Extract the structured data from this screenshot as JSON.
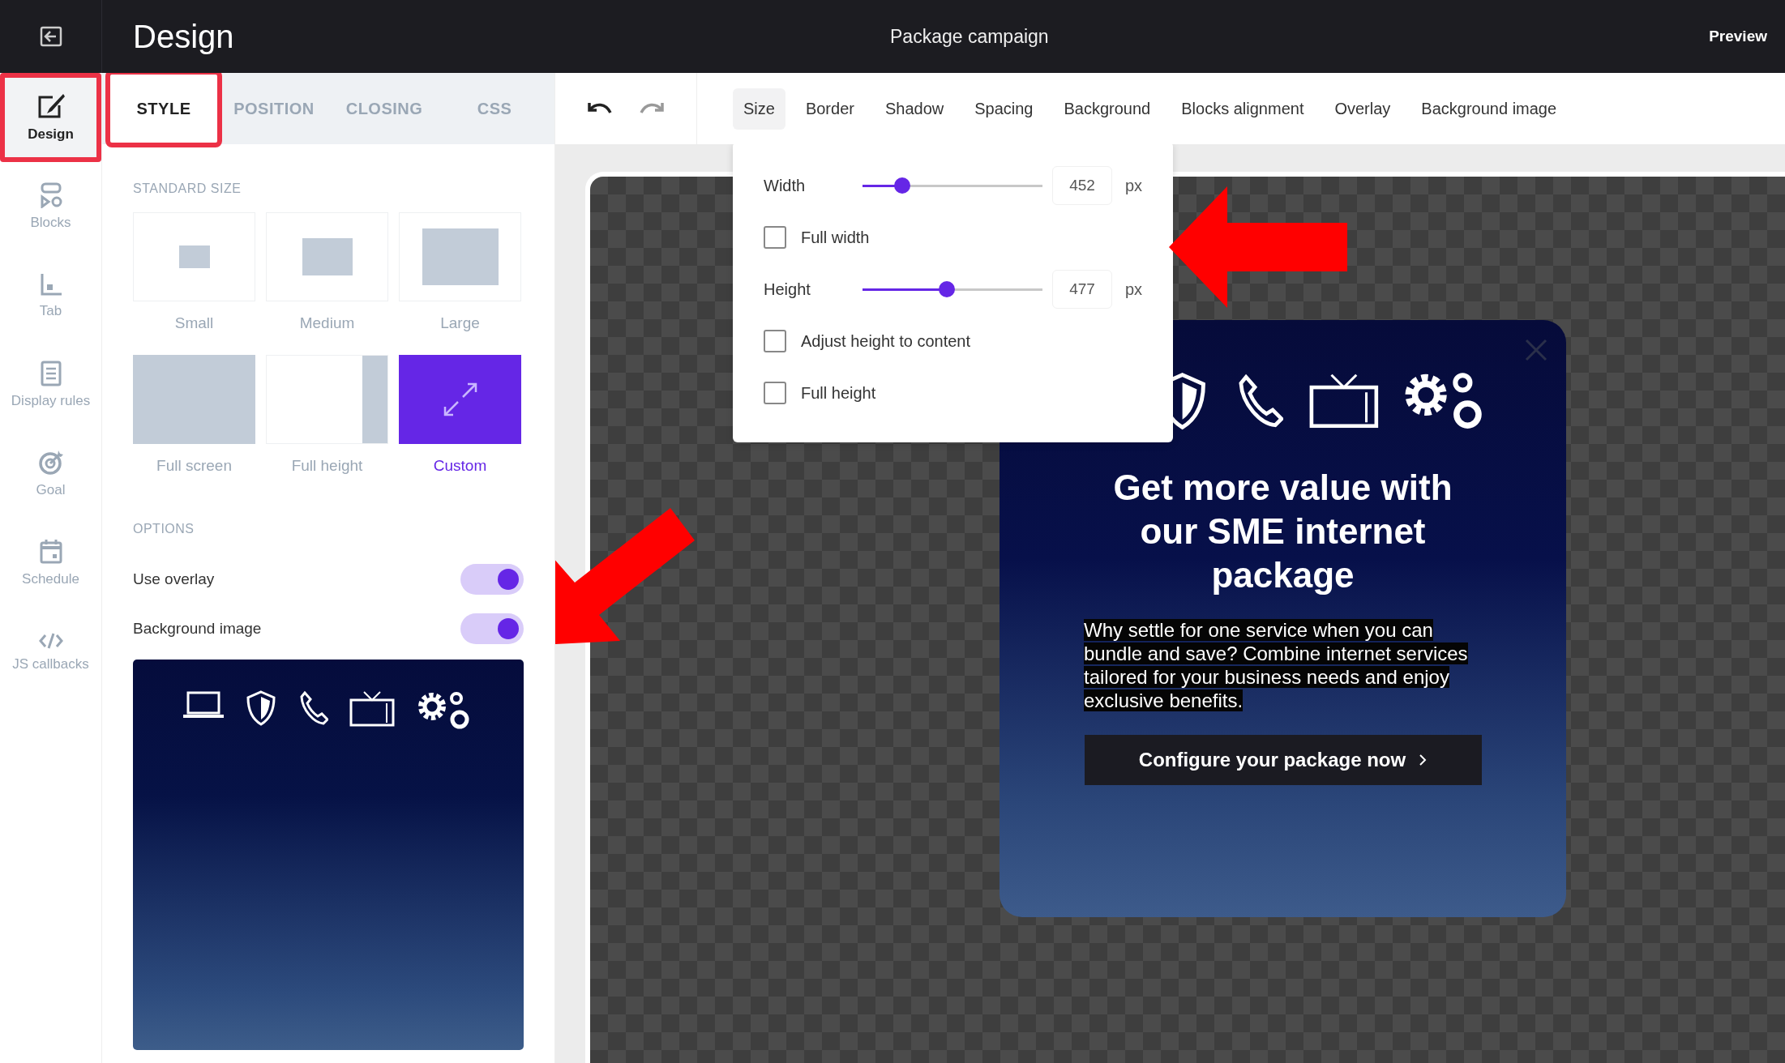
{
  "header": {
    "title": "Design",
    "campaign": "Package campaign",
    "preview": "Preview"
  },
  "rail": [
    {
      "label": "Design",
      "selected": true,
      "highlighted": true
    },
    {
      "label": "Blocks",
      "selected": false,
      "highlighted": false
    },
    {
      "label": "Tab",
      "selected": false,
      "highlighted": false
    },
    {
      "label": "Display rules",
      "selected": false,
      "highlighted": false
    },
    {
      "label": "Goal",
      "selected": false,
      "highlighted": false
    },
    {
      "label": "Schedule",
      "selected": false,
      "highlighted": false
    },
    {
      "label": "JS callbacks",
      "selected": false,
      "highlighted": false
    }
  ],
  "panel_tabs": [
    {
      "label": "STYLE",
      "selected": true,
      "highlighted": true
    },
    {
      "label": "POSITION",
      "selected": false,
      "highlighted": false
    },
    {
      "label": "CLOSING",
      "selected": false,
      "highlighted": false
    },
    {
      "label": "CSS",
      "selected": false,
      "highlighted": false
    }
  ],
  "standard_size": {
    "heading": "STANDARD SIZE",
    "options": [
      {
        "kind": "small",
        "label": "Small",
        "selected": false
      },
      {
        "kind": "medium",
        "label": "Medium",
        "selected": false
      },
      {
        "kind": "large",
        "label": "Large",
        "selected": false
      },
      {
        "kind": "full-screen",
        "label": "Full screen",
        "selected": false
      },
      {
        "kind": "full-height",
        "label": "Full height",
        "selected": false
      },
      {
        "kind": "custom",
        "label": "Custom",
        "selected": true
      }
    ]
  },
  "options": {
    "heading": "OPTIONS",
    "toggles": [
      {
        "label": "Use overlay",
        "on": true
      },
      {
        "label": "Background image",
        "on": true
      }
    ]
  },
  "toolbar": {
    "tabs": [
      {
        "label": "Size",
        "selected": true
      },
      {
        "label": "Border",
        "selected": false
      },
      {
        "label": "Shadow",
        "selected": false
      },
      {
        "label": "Spacing",
        "selected": false
      },
      {
        "label": "Background",
        "selected": false
      },
      {
        "label": "Blocks alignment",
        "selected": false
      },
      {
        "label": "Overlay",
        "selected": false
      },
      {
        "label": "Background image",
        "selected": false
      }
    ]
  },
  "size_popover": {
    "rows": [
      {
        "kind": "slider",
        "label": "Width",
        "level": 0.22,
        "value": "452",
        "unit": "px"
      },
      {
        "kind": "checkbox",
        "label": "Full width",
        "checked": false
      },
      {
        "kind": "slider",
        "label": "Height",
        "level": 0.47,
        "value": "477",
        "unit": "px"
      },
      {
        "kind": "checkbox",
        "label": "Adjust height to content",
        "checked": false
      },
      {
        "kind": "checkbox",
        "label": "Full height",
        "checked": false
      }
    ]
  },
  "popup": {
    "title": "Get more value with our SME internet package",
    "body": "Why settle for one service when you can bundle and save? Combine internet services tailored for your business needs and enjoy exclusive benefits.",
    "cta": "Configure your package now"
  }
}
